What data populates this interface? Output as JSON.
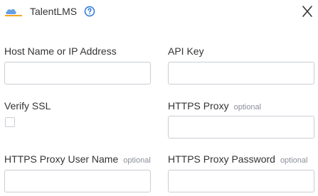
{
  "header": {
    "app_name": "TalentLMS",
    "logo_icon": "talentlms-logo-icon",
    "help_icon": "help-circle-icon",
    "close_icon": "close-icon",
    "accent_color": "#1e6fd9"
  },
  "form": {
    "host": {
      "label": "Host Name or IP Address",
      "value": ""
    },
    "api_key": {
      "label": "API Key",
      "value": ""
    },
    "verify_ssl": {
      "label": "Verify SSL",
      "checked": false
    },
    "https_proxy": {
      "label": "HTTPS Proxy",
      "optional": "optional",
      "value": ""
    },
    "proxy_user": {
      "label": "HTTPS Proxy User Name",
      "optional": "optional",
      "value": ""
    },
    "proxy_password": {
      "label": "HTTPS Proxy Password",
      "optional": "optional",
      "value": ""
    }
  }
}
